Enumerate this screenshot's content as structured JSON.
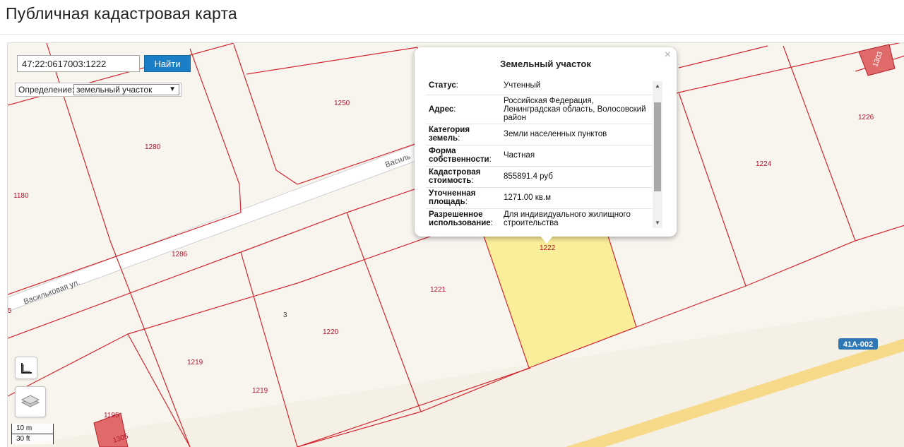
{
  "header": {
    "title": "Публичная кадастровая карта"
  },
  "search": {
    "value": "47:22:0617003:1222",
    "button_label": "Найти"
  },
  "definition": {
    "label": "Определение:",
    "selected": "земельный участок"
  },
  "popup": {
    "title": "Земельный участок",
    "close_symbol": "×",
    "rows": [
      {
        "key": "Статус",
        "value": "Учтенный"
      },
      {
        "key": "Адрес",
        "value": "Российская Федерация, Ленинградская область, Волосовский район"
      },
      {
        "key": "Категория земель",
        "value": "Земли населенных пунктов"
      },
      {
        "key": "Форма собственности",
        "value": "Частная"
      },
      {
        "key": "Кадастровая стоимость",
        "value": "855891.4 руб"
      },
      {
        "key": "Уточненная площадь",
        "value": "1271.00 кв.м"
      },
      {
        "key": "Разрешенное использование",
        "value": "Для индивидуального жилищного строительства"
      }
    ]
  },
  "map": {
    "plot_labels": [
      "1250",
      "1280",
      "1180",
      "1286",
      "1221",
      "1220",
      "1219",
      "1219",
      "1226",
      "1224",
      "1222",
      "1195",
      "1305",
      "1303",
      "5",
      "3"
    ],
    "street_labels": [
      "Васильковая ул.",
      "Василь"
    ],
    "road_label": "41A-002",
    "scale": {
      "metric": "10 m",
      "imperial": "30 ft"
    },
    "colors": {
      "plot_border": "#d3272f",
      "selected_fill": "#fbee9a",
      "road": "#f7d98a",
      "building": "#e06a6a"
    }
  }
}
